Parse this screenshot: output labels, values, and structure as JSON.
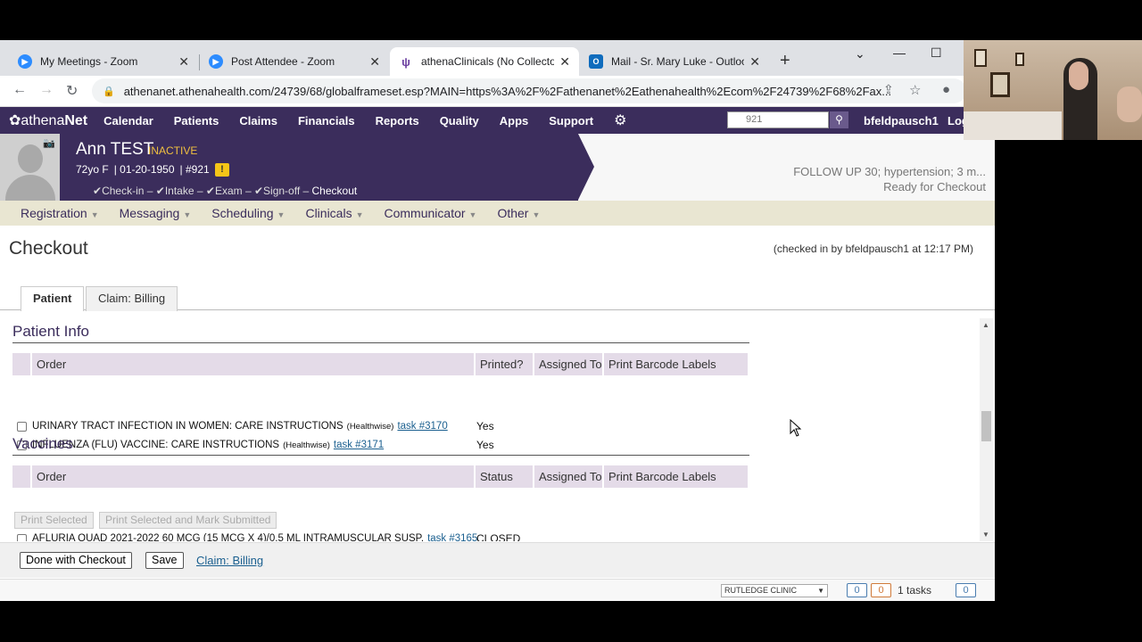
{
  "browser": {
    "tabs": [
      {
        "label": "My Meetings - Zoom",
        "icon": "zoom-icon",
        "color": "#2d8cff"
      },
      {
        "label": "Post Attendee - Zoom",
        "icon": "zoom-icon",
        "color": "#2d8cff"
      },
      {
        "label": "athenaClinicals (No Collector) \\",
        "icon": "athena-icon",
        "color": "#6b3fa0"
      },
      {
        "label": "Mail - Sr. Mary Luke - Outlook",
        "icon": "outlook-icon",
        "color": "#0f6cbd"
      }
    ],
    "url": "athenanet.athenahealth.com/24739/68/globalframeset.esp?MAIN=https%3A%2F%2Fathenanet%2Eathenahealth%2Ecom%2F24739%2F68%2Fax..."
  },
  "athena_nav": {
    "logo_a": "athena",
    "logo_b": "Net",
    "items": [
      "Calendar",
      "Patients",
      "Claims",
      "Financials",
      "Reports",
      "Quality",
      "Apps",
      "Support"
    ],
    "search_value": "921",
    "user": "bfeldpausch1",
    "logout": "Log"
  },
  "patient": {
    "name": "Ann TEST",
    "status": "INACTIVE",
    "age_sex": "72yo F",
    "dob": "01-20-1950",
    "id": "#921",
    "alert": "!",
    "workflow": [
      "Check-in",
      "Intake",
      "Exam",
      "Sign-off"
    ],
    "workflow_current": "Checkout",
    "reason": "FOLLOW UP 30; hypertension; 3 m...",
    "state": "Ready for Checkout"
  },
  "menu": [
    "Registration",
    "Messaging",
    "Scheduling",
    "Clinicals",
    "Communicator",
    "Other"
  ],
  "page": {
    "title": "Checkout",
    "checked_in": "(checked in by bfeldpausch1 at 12:17 PM)",
    "tabs": [
      "Patient",
      "Claim: Billing"
    ]
  },
  "patient_info": {
    "heading": "Patient Info",
    "columns": [
      "Order",
      "Printed?",
      "Assigned To",
      "Print Barcode Labels"
    ],
    "rows": [
      {
        "order": "URINARY TRACT INFECTION IN WOMEN: CARE INSTRUCTIONS",
        "source": "(Healthwise)",
        "task": "task #3170",
        "printed": "Yes"
      },
      {
        "order": "INFLUENZA (FLU) VACCINE: CARE INSTRUCTIONS",
        "source": "(Healthwise)",
        "task": "task #3171",
        "printed": "Yes"
      }
    ]
  },
  "vaccines": {
    "heading": "Vaccines",
    "columns": [
      "Order",
      "Status",
      "Assigned To",
      "Print Barcode Labels"
    ],
    "rows": [
      {
        "order": "AFLURIA QUAD 2021-2022 60 MCG (15 MCG X 4)/0.5 ML INTRAMUSCULAR SUSP.",
        "task": "task #3165",
        "status": "CLOSED"
      }
    ],
    "print_selected": "Print Selected",
    "print_mark": "Print Selected and Mark Submitted"
  },
  "footer": {
    "done": "Done with Checkout",
    "save": "Save",
    "claim_link": "Claim: Billing"
  },
  "statusbar": {
    "clinic": "RUTLEDGE CLINIC",
    "count_a": "0",
    "count_b": "0",
    "tasks": "1 tasks",
    "msgs": "0"
  }
}
